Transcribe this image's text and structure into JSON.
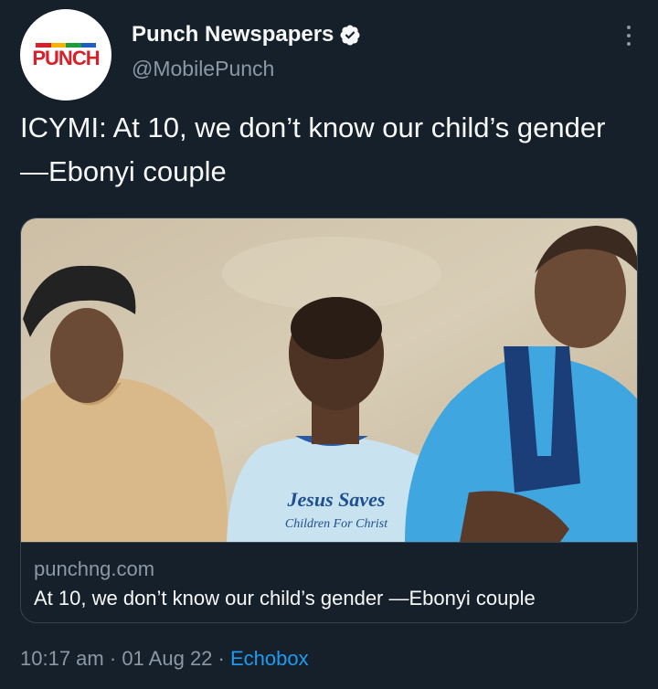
{
  "account": {
    "avatar_text": "PUNCH",
    "display_name": "Punch Newspapers",
    "handle": "@MobilePunch",
    "verified": true,
    "icons": {
      "verified": "verified-badge-icon",
      "more": "more-options-icon"
    }
  },
  "tweet": {
    "text": "ICYMI: At 10, we don’t know our child’s gender —Ebonyi couple"
  },
  "card": {
    "image_shirt_line1": "Jesus Saves",
    "image_shirt_line2": "Children For Christ",
    "domain": "punchng.com",
    "title": "At 10, we don’t know our child’s gender —Ebonyi couple"
  },
  "meta": {
    "time": "10:17 am",
    "date": "01 Aug 22",
    "source": "Echobox",
    "separator": "·"
  },
  "colors": {
    "background": "#15202b",
    "text": "#f7f9f9",
    "secondary": "#8b98a5",
    "accent": "#1d9bf0",
    "punch_red": "#d6202a"
  }
}
